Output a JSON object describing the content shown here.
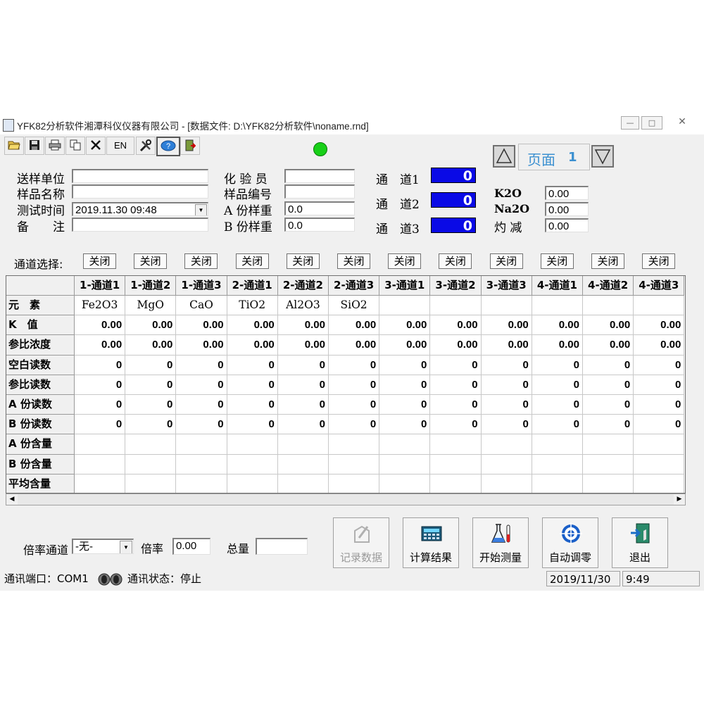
{
  "window": {
    "title": "YFK82分析软件湘潭科仪仪器有限公司 - [数据文件: D:\\YFK82分析软件\\noname.rnd]",
    "min_label": "—",
    "max_label": "□",
    "close_label": "✕"
  },
  "toolbar": {
    "en_label": "EN"
  },
  "form": {
    "sender_label": "送样单位",
    "sender_value": "",
    "sample_name_label": "样品名称",
    "sample_name_value": "",
    "test_time_label": "测试时间",
    "test_time_value": "2019.11.30 09:48",
    "remark_label": "备　　注",
    "remark_value": "",
    "chemist_label": "化 验 员",
    "chemist_value": "",
    "sample_no_label": "样品编号",
    "sample_no_value": "",
    "a_weight_label": "A 份样重",
    "a_weight_value": "0.0",
    "b_weight_label": "B 份样重",
    "b_weight_value": "0.0"
  },
  "channels": [
    {
      "label": "通　道1",
      "value": "0"
    },
    {
      "label": "通　道2",
      "value": "0"
    },
    {
      "label": "通　道3",
      "value": "0"
    }
  ],
  "page": {
    "label": "页面",
    "number": "1"
  },
  "oxides": [
    {
      "label": "K2O",
      "value": "0.00"
    },
    {
      "label": "Na2O",
      "value": "0.00"
    },
    {
      "label": "灼 减",
      "value": "0.00"
    }
  ],
  "channel_select": {
    "label": "通道选择:",
    "buttons": [
      "关闭",
      "关闭",
      "关闭",
      "关闭",
      "关闭",
      "关闭",
      "关闭",
      "关闭",
      "关闭",
      "关闭",
      "关闭",
      "关闭"
    ]
  },
  "table": {
    "columns": [
      "1-通道1",
      "1-通道2",
      "1-通道3",
      "2-通道1",
      "2-通道2",
      "2-通道3",
      "3-通道1",
      "3-通道2",
      "3-通道3",
      "4-通道1",
      "4-通道2",
      "4-通道3"
    ],
    "rows": [
      {
        "label": "元　素",
        "cells": [
          "Fe2O3",
          "MgO",
          "CaO",
          "TiO2",
          "Al2O3",
          "SiO2",
          "",
          "",
          "",
          "",
          "",
          ""
        ]
      },
      {
        "label": "K　值",
        "cells": [
          "0.00",
          "0.00",
          "0.00",
          "0.00",
          "0.00",
          "0.00",
          "0.00",
          "0.00",
          "0.00",
          "0.00",
          "0.00",
          "0.00"
        ]
      },
      {
        "label": "参比浓度",
        "cells": [
          "0.00",
          "0.00",
          "0.00",
          "0.00",
          "0.00",
          "0.00",
          "0.00",
          "0.00",
          "0.00",
          "0.00",
          "0.00",
          "0.00"
        ]
      },
      {
        "label": "空白读数",
        "cells": [
          "0",
          "0",
          "0",
          "0",
          "0",
          "0",
          "0",
          "0",
          "0",
          "0",
          "0",
          "0"
        ]
      },
      {
        "label": "参比读数",
        "cells": [
          "0",
          "0",
          "0",
          "0",
          "0",
          "0",
          "0",
          "0",
          "0",
          "0",
          "0",
          "0"
        ]
      },
      {
        "label": "A 份读数",
        "cells": [
          "0",
          "0",
          "0",
          "0",
          "0",
          "0",
          "0",
          "0",
          "0",
          "0",
          "0",
          "0"
        ]
      },
      {
        "label": "B 份读数",
        "cells": [
          "0",
          "0",
          "0",
          "0",
          "0",
          "0",
          "0",
          "0",
          "0",
          "0",
          "0",
          "0"
        ]
      },
      {
        "label": "A 份含量",
        "cells": [
          "",
          "",
          "",
          "",
          "",
          "",
          "",
          "",
          "",
          "",
          "",
          ""
        ]
      },
      {
        "label": "B 份含量",
        "cells": [
          "",
          "",
          "",
          "",
          "",
          "",
          "",
          "",
          "",
          "",
          "",
          ""
        ]
      },
      {
        "label": "平均含量",
        "cells": [
          "",
          "",
          "",
          "",
          "",
          "",
          "",
          "",
          "",
          "",
          "",
          ""
        ]
      }
    ]
  },
  "bottom": {
    "rate_channel_label": "倍率通道",
    "rate_channel_value": "-无-",
    "rate_label": "倍率",
    "rate_value": "0.00",
    "total_label": "总量",
    "total_value": ""
  },
  "actions": {
    "record": "记录数据",
    "compute": "计算结果",
    "start": "开始测量",
    "autozero": "自动调零",
    "exit": "退出"
  },
  "status": {
    "port": "通讯端口：COM1",
    "state": "通讯状态：停止",
    "date": "2019/11/30",
    "time": "9:49"
  }
}
